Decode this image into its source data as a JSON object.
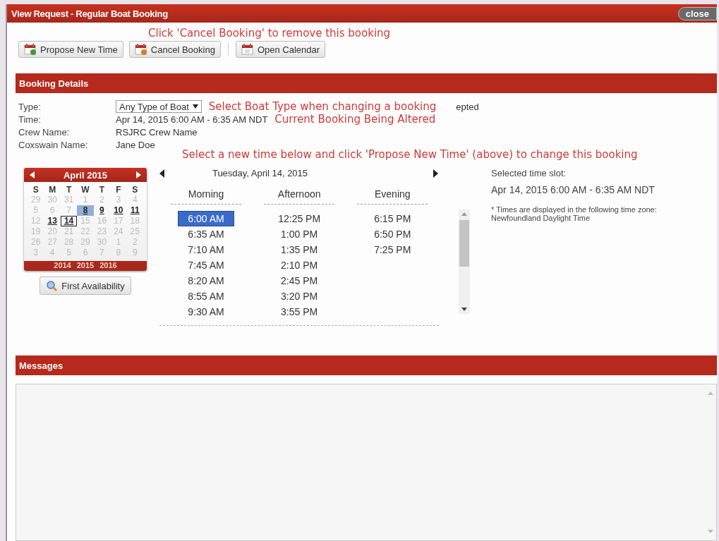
{
  "window": {
    "title": "View Request - Regular Boat Booking",
    "close": "close"
  },
  "toolbar": {
    "note": "Click 'Cancel Booking' to remove this booking",
    "buttons": [
      {
        "label": "Propose New Time",
        "kind": "propose"
      },
      {
        "label": "Cancel Booking",
        "kind": "cancel"
      },
      {
        "label": "Open Calendar",
        "kind": "calendar"
      }
    ]
  },
  "booking_details": {
    "title": "Booking Details",
    "fields": [
      {
        "label": "Type:",
        "kind": "select",
        "value": "Any Type of Boat",
        "note": "Select Boat Type when changing a booking",
        "trailing": "epted"
      },
      {
        "label": "Time:",
        "kind": "text",
        "value": "Apr 14, 2015 6:00 AM - 6:35 AM NDT",
        "note": "Current Booking Being Altered"
      },
      {
        "label": "Crew Name:",
        "kind": "text",
        "value": "RSJRC Crew Name"
      },
      {
        "label": "Coxswain Name:",
        "kind": "text",
        "value": "Jane Doe"
      }
    ],
    "instruction": "Select a new time below and click 'Propose New Time' (above) to change this booking"
  },
  "calendar": {
    "month": "April 2015",
    "weekdays": [
      "S",
      "M",
      "T",
      "W",
      "T",
      "F",
      "S"
    ],
    "days": [
      {
        "label": "29",
        "available": false,
        "today": false,
        "selected": false
      },
      {
        "label": "30",
        "available": false,
        "today": false,
        "selected": false
      },
      {
        "label": "31",
        "available": false,
        "today": false,
        "selected": false
      },
      {
        "label": "1",
        "available": false,
        "today": false,
        "selected": false
      },
      {
        "label": "2",
        "available": false,
        "today": false,
        "selected": false
      },
      {
        "label": "3",
        "available": false,
        "today": false,
        "selected": false
      },
      {
        "label": "4",
        "available": false,
        "today": false,
        "selected": false
      },
      {
        "label": "5",
        "available": false,
        "today": false,
        "selected": false
      },
      {
        "label": "6",
        "available": false,
        "today": false,
        "selected": false
      },
      {
        "label": "7",
        "available": false,
        "today": false,
        "selected": false
      },
      {
        "label": "8",
        "available": true,
        "today": true,
        "selected": false
      },
      {
        "label": "9",
        "available": true,
        "today": false,
        "selected": false
      },
      {
        "label": "10",
        "available": true,
        "today": false,
        "selected": false
      },
      {
        "label": "11",
        "available": true,
        "today": false,
        "selected": false
      },
      {
        "label": "12",
        "available": false,
        "today": false,
        "selected": false
      },
      {
        "label": "13",
        "available": true,
        "today": false,
        "selected": false
      },
      {
        "label": "14",
        "available": true,
        "today": false,
        "selected": true
      },
      {
        "label": "15",
        "available": false,
        "today": false,
        "selected": false
      },
      {
        "label": "16",
        "available": false,
        "today": false,
        "selected": false
      },
      {
        "label": "17",
        "available": false,
        "today": false,
        "selected": false
      },
      {
        "label": "18",
        "available": false,
        "today": false,
        "selected": false
      },
      {
        "label": "19",
        "available": false,
        "today": false,
        "selected": false
      },
      {
        "label": "20",
        "available": false,
        "today": false,
        "selected": false
      },
      {
        "label": "21",
        "available": false,
        "today": false,
        "selected": false
      },
      {
        "label": "22",
        "available": false,
        "today": false,
        "selected": false
      },
      {
        "label": "23",
        "available": false,
        "today": false,
        "selected": false
      },
      {
        "label": "24",
        "available": false,
        "today": false,
        "selected": false
      },
      {
        "label": "25",
        "available": false,
        "today": false,
        "selected": false
      },
      {
        "label": "26",
        "available": false,
        "today": false,
        "selected": false
      },
      {
        "label": "27",
        "available": false,
        "today": false,
        "selected": false
      },
      {
        "label": "28",
        "available": false,
        "today": false,
        "selected": false
      },
      {
        "label": "29",
        "available": false,
        "today": false,
        "selected": false
      },
      {
        "label": "30",
        "available": false,
        "today": false,
        "selected": false
      },
      {
        "label": "1",
        "available": false,
        "today": false,
        "selected": false
      },
      {
        "label": "2",
        "available": false,
        "today": false,
        "selected": false
      },
      {
        "label": "3",
        "available": false,
        "today": false,
        "selected": false
      },
      {
        "label": "4",
        "available": false,
        "today": false,
        "selected": false
      },
      {
        "label": "5",
        "available": false,
        "today": false,
        "selected": false
      },
      {
        "label": "6",
        "available": false,
        "today": false,
        "selected": false
      },
      {
        "label": "7",
        "available": false,
        "today": false,
        "selected": false
      },
      {
        "label": "8",
        "available": false,
        "today": false,
        "selected": false
      },
      {
        "label": "9",
        "available": false,
        "today": false,
        "selected": false
      }
    ],
    "years": [
      "2014",
      "2015",
      "2016"
    ],
    "button": "First Availability"
  },
  "time_slots": {
    "date": "Tuesday, April 14, 2015",
    "columns": [
      {
        "heading": "Morning",
        "slots": [
          {
            "time": "6:00 AM",
            "selected": true
          },
          {
            "time": "6:35 AM",
            "selected": false
          },
          {
            "time": "7:10 AM",
            "selected": false
          },
          {
            "time": "7:45 AM",
            "selected": false
          },
          {
            "time": "8:20 AM",
            "selected": false
          },
          {
            "time": "8:55 AM",
            "selected": false
          },
          {
            "time": "9:30 AM",
            "selected": false
          }
        ]
      },
      {
        "heading": "Afternoon",
        "slots": [
          {
            "time": "12:25 PM",
            "selected": false
          },
          {
            "time": "1:00 PM",
            "selected": false
          },
          {
            "time": "1:35 PM",
            "selected": false
          },
          {
            "time": "2:10 PM",
            "selected": false
          },
          {
            "time": "2:45 PM",
            "selected": false
          },
          {
            "time": "3:20 PM",
            "selected": false
          },
          {
            "time": "3:55 PM",
            "selected": false
          }
        ]
      },
      {
        "heading": "Evening",
        "slots": [
          {
            "time": "6:15 PM",
            "selected": false
          },
          {
            "time": "6:50 PM",
            "selected": false
          },
          {
            "time": "7:25 PM",
            "selected": false
          }
        ]
      }
    ]
  },
  "selection": {
    "label": "Selected time slot:",
    "value": "Apr 14, 2015 6:00 AM - 6:35 AM NDT",
    "note": "* Times are displayed in the following time zone: Newfoundland Daylight Time"
  },
  "messages": {
    "title": "Messages"
  }
}
